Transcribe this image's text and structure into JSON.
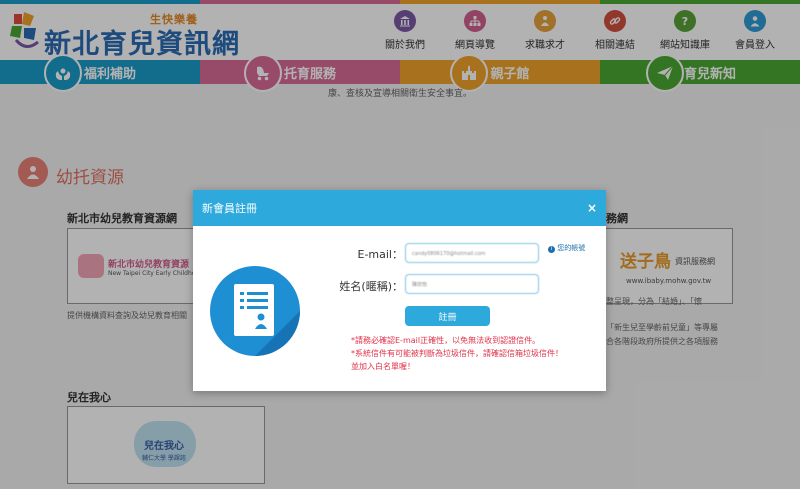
{
  "header": {
    "logo_title": "新北育兒資訊網",
    "logo_sub": "生快樂養"
  },
  "top_nav": [
    {
      "label": "關於我們",
      "icon": "bank-icon",
      "color": "#7a5aa6"
    },
    {
      "label": "網頁導覽",
      "icon": "sitemap-icon",
      "color": "#d15f8e"
    },
    {
      "label": "求職求才",
      "icon": "briefcase-icon",
      "color": "#e8a23b"
    },
    {
      "label": "相關連結",
      "icon": "link-icon",
      "color": "#d14f3f"
    },
    {
      "label": "網站知識庫",
      "icon": "question-icon",
      "color": "#5aa338"
    },
    {
      "label": "會員登入",
      "icon": "user-icon",
      "color": "#2e9bd6"
    }
  ],
  "main_nav": [
    {
      "label": "福利補助",
      "icon": "hands-icon",
      "color": "#1a9bc8"
    },
    {
      "label": "托育服務",
      "icon": "stroller-icon",
      "color": "#d96c97"
    },
    {
      "label": "親子館",
      "icon": "castle-icon",
      "color": "#f0a32a"
    },
    {
      "label": "育兒新知",
      "icon": "paper-plane-icon",
      "color": "#4aa832"
    }
  ],
  "notice": "康、查核及宣導相關衛生安全事宜。",
  "section": {
    "title": "幼托資源"
  },
  "cards": {
    "edu_title": "新北市幼兒教育資源網",
    "edu_logo_cn": "新北市幼兒教育資源",
    "edu_logo_en": "New Taipei City Early Childhood",
    "edu_desc": "提供機構資料查詢及幼兒教育相關",
    "bird_title_suffix": "務網",
    "bird_logo": "送子鳥",
    "bird_logo_sub": "資訊服務網",
    "bird_url": "www.ibaby.mohw.gov.tw",
    "bird_desc_1": "整呈現，分為「結婚」、「懷",
    "bird_desc_2": "「新生兒至學齡前兒童」等專屬",
    "bird_desc_3": "合各階段政府所提供之各項服務",
    "kids_title": "兒在我心",
    "kids_logo": "兒在我心",
    "kids_logo_sub": "輔仁大學 學課諮"
  },
  "modal": {
    "title": "新會員註冊",
    "close": "×",
    "email_label": "E-mail：",
    "email_value": "candy0806170@hotmail.com",
    "name_label": "姓名(暱稱)：",
    "name_value": "陳欣怡",
    "account_link": "您的帳號",
    "submit_label": "註冊",
    "warning_1": "*請務必確認E-mail正確性，以免無法收到認證信件。",
    "warning_2": "*系統信件有可能被判斷為垃圾信件，請確認信箱垃圾信件！",
    "warning_3": "並加入白名單喔！"
  },
  "colors": {
    "accent": "#2ea9dc",
    "warning": "#e0334a"
  }
}
